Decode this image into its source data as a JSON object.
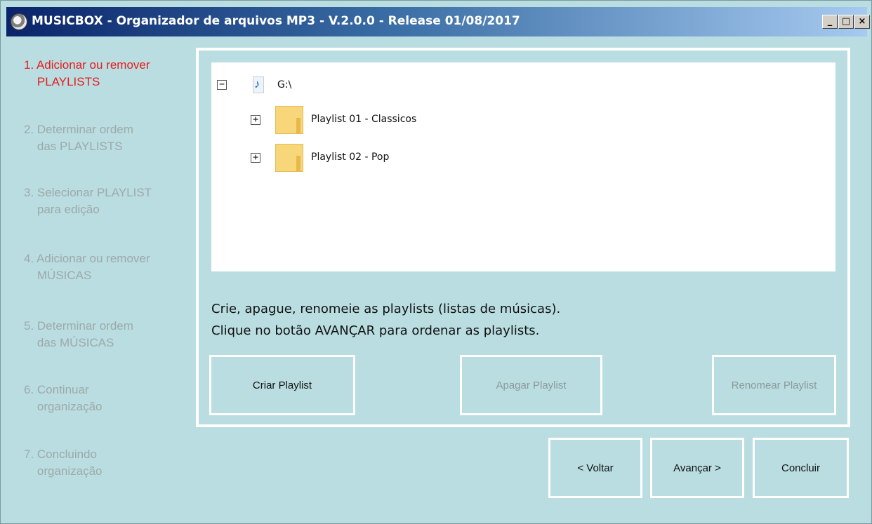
{
  "window": {
    "title": "MUSICBOX - Organizador de arquivos MP3  -  V.2.0.0  -  Release 01/08/2017",
    "min_label": "_",
    "max_label": "□",
    "close_label": "×"
  },
  "steps": [
    {
      "label": "1. Adicionar ou remover\n    PLAYLISTS",
      "active": true
    },
    {
      "label": "2. Determinar ordem\n    das PLAYLISTS",
      "active": false
    },
    {
      "label": "3. Selecionar PLAYLIST\n    para edição",
      "active": false
    },
    {
      "label": "4. Adicionar ou remover\n    MÚSICAS",
      "active": false
    },
    {
      "label": "5. Determinar ordem\n    das MÚSICAS",
      "active": false
    },
    {
      "label": "6. Continuar\n    organização",
      "active": false
    },
    {
      "label": "7. Concluindo\n    organização",
      "active": false
    }
  ],
  "tree": {
    "root": {
      "label": "G:\\",
      "expander": "−",
      "icon": "music-file-icon"
    },
    "playlists": [
      {
        "label": "Playlist 01 - Classicos",
        "expander": "+",
        "icon": "folder-icon"
      },
      {
        "label": "Playlist 02 - Pop",
        "expander": "+",
        "icon": "folder-icon"
      }
    ]
  },
  "instructions": {
    "line1": "Crie, apague, renomeie as playlists (listas de músicas).",
    "line2": "Clique no botão AVANÇAR para ordenar as playlists."
  },
  "actions": {
    "criar": "Criar Playlist",
    "apagar": "Apagar Playlist",
    "renomear": "Renomear Playlist"
  },
  "nav": {
    "voltar": "< Voltar",
    "avancar": "Avançar >",
    "concluir": "Concluir"
  },
  "colors": {
    "background": "#b9dde0",
    "active_step": "#e81c1c",
    "inactive_step": "#9ea9ab"
  }
}
